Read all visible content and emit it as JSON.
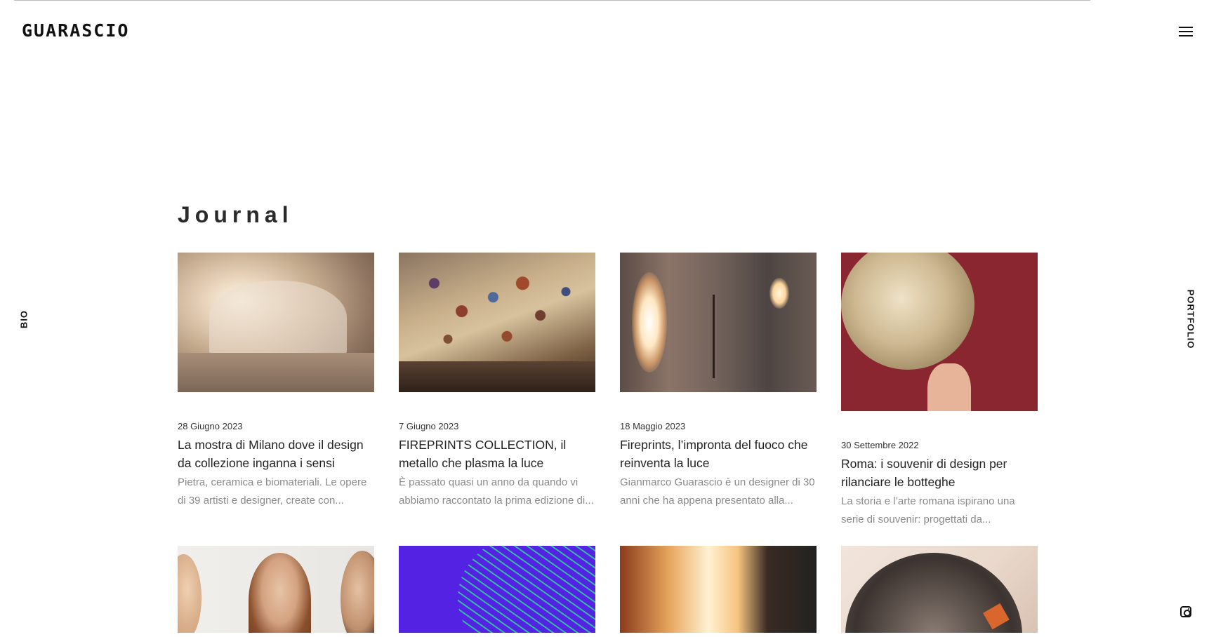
{
  "header": {
    "logo_text": "GUARASCIO",
    "menu_icon": "hamburger-menu-icon"
  },
  "side_nav": {
    "left_label": "BIO",
    "right_label": "PORTFOLIO",
    "social_icon": "instagram-icon"
  },
  "journal": {
    "title": "Journal",
    "posts": [
      {
        "date": "28 Giugno 2023",
        "title": "La mostra di Milano dove il design da collezione inganna i sensi",
        "excerpt": "Pietra, ceramica e biomateriali. Le opere di 39 artisti e designer, create con...",
        "image": "stone-cave-exhibition"
      },
      {
        "date": "7 Giugno 2023",
        "title": "FIREPRINTS COLLECTION, il metallo che plasma la luce",
        "excerpt": "È passato quasi un anno da quando vi abbiamo raccontato la prima edizione di...",
        "image": "dappled-light-projection"
      },
      {
        "date": "18 Maggio 2023",
        "title": "Fireprints, l’impronta del fuoco che reinventa la luce",
        "excerpt": "Gianmarco Guarascio è un designer di 30 anni che ha appena presentato alla...",
        "image": "wall-lamps"
      },
      {
        "date": "30 Settembre 2022",
        "title": "Roma: i souvenir di design per rilanciare le botteghe",
        "excerpt": "La storia e l’arte romana ispirano una serie di souvenir: progettati da...",
        "image": "bronze-medal-in-hand"
      }
    ],
    "next_row_images": [
      "three-women-portrait",
      "purple-green-graphic",
      "fire-flames",
      "metal-dish"
    ]
  }
}
